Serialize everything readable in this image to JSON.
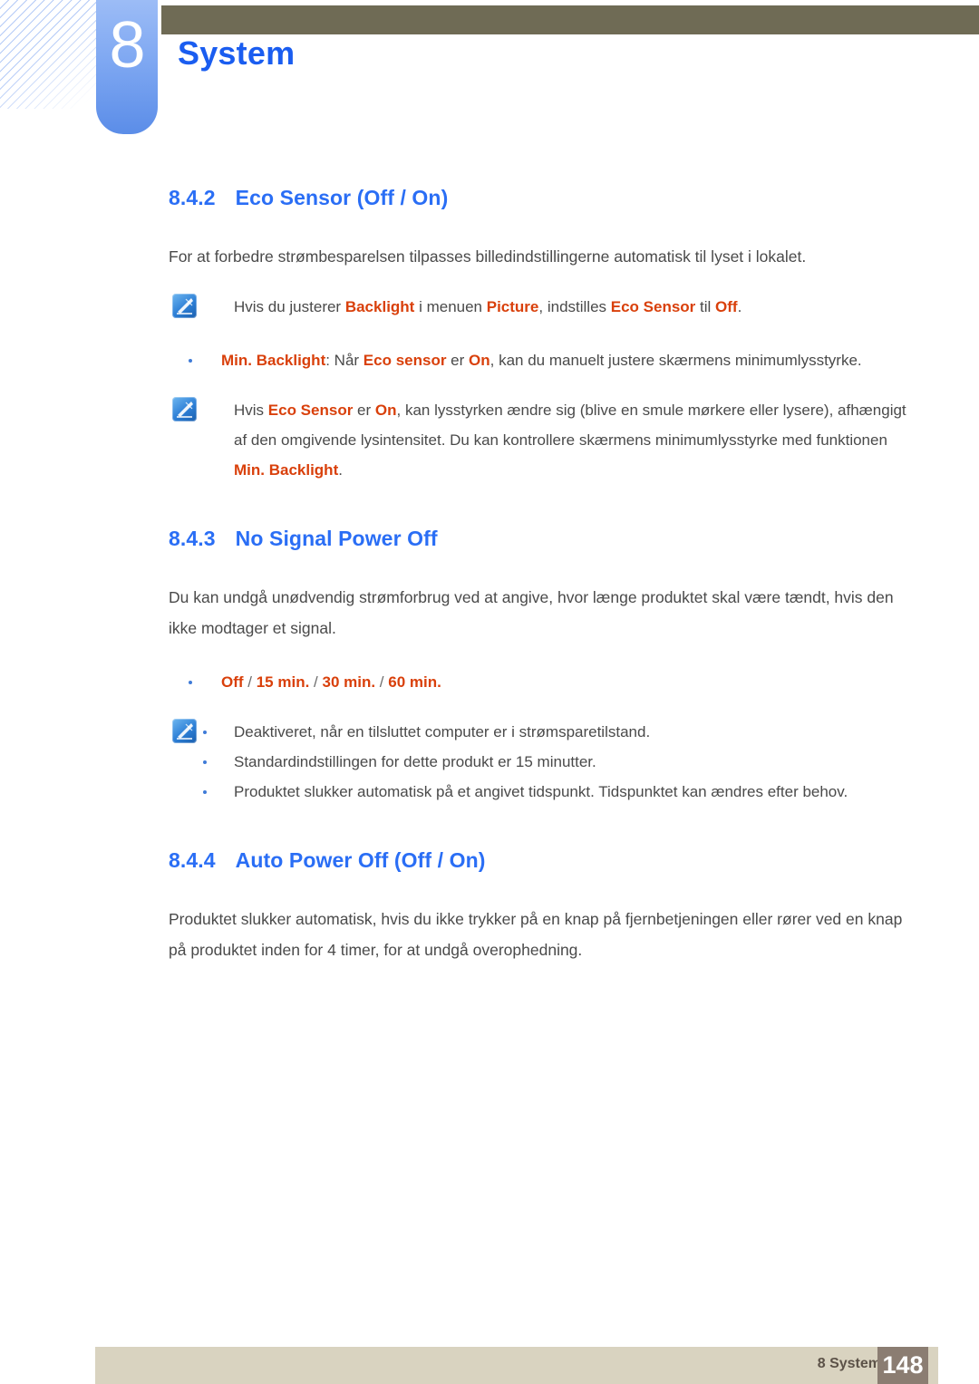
{
  "header": {
    "chapter_number": "8",
    "chapter_title": "System"
  },
  "sections": [
    {
      "number": "8.4.2",
      "title": "Eco Sensor (Off / On)"
    },
    {
      "number": "8.4.3",
      "title": "No Signal Power Off"
    },
    {
      "number": "8.4.4",
      "title": "Auto Power Off (Off / On)"
    }
  ],
  "eco_sensor": {
    "intro": "For at forbedre strømbesparelsen tilpasses billedindstillingerne automatisk til lyset i lokalet.",
    "note1": {
      "icon": "note-pen-icon",
      "text_parts": [
        {
          "t": "Hvis du justerer ",
          "hl": false
        },
        {
          "t": "Backlight",
          "hl": true
        },
        {
          "t": " i menuen ",
          "hl": false
        },
        {
          "t": "Picture",
          "hl": true
        },
        {
          "t": ", indstilles ",
          "hl": false
        },
        {
          "t": "Eco Sensor",
          "hl": true
        },
        {
          "t": " til ",
          "hl": false
        },
        {
          "t": "Off",
          "hl": true
        },
        {
          "t": ".",
          "hl": false
        }
      ]
    },
    "bullet1_parts": [
      {
        "t": "Min. Backlight",
        "hl": true
      },
      {
        "t": ": Når ",
        "hl": false
      },
      {
        "t": "Eco sensor",
        "hl": true
      },
      {
        "t": " er ",
        "hl": false
      },
      {
        "t": "On",
        "hl": true
      },
      {
        "t": ", kan du manuelt justere skærmens minimumlysstyrke.",
        "hl": false
      }
    ],
    "note2": {
      "icon": "note-pen-icon",
      "text_parts": [
        {
          "t": "Hvis ",
          "hl": false
        },
        {
          "t": "Eco Sensor",
          "hl": true
        },
        {
          "t": " er ",
          "hl": false
        },
        {
          "t": "On",
          "hl": true
        },
        {
          "t": ", kan lysstyrken ændre sig (blive en smule mørkere eller lysere), afhængigt af den omgivende lysintensitet. Du kan kontrollere skærmens minimumlysstyrke med funktionen ",
          "hl": false
        },
        {
          "t": "Min. Backlight",
          "hl": true
        },
        {
          "t": ".",
          "hl": false
        }
      ]
    }
  },
  "no_signal_power_off": {
    "intro": "Du kan undgå unødvendig strømforbrug ved at angive, hvor længe produktet skal være tændt, hvis den ikke modtager et signal.",
    "options_parts": [
      {
        "t": "Off",
        "hl": true
      },
      {
        "t": " / ",
        "sep": true
      },
      {
        "t": "15 min.",
        "hl": true
      },
      {
        "t": " / ",
        "sep": true
      },
      {
        "t": "30 min.",
        "hl": true
      },
      {
        "t": " / ",
        "sep": true
      },
      {
        "t": "60 min.",
        "hl": true
      }
    ],
    "note": {
      "icon": "note-pen-icon",
      "bullets": [
        "Deaktiveret, når en tilsluttet computer er i strømsparetilstand.",
        "Standardindstillingen for dette produkt er 15 minutter.",
        "Produktet slukker automatisk på et angivet tidspunkt. Tidspunktet kan ændres efter behov."
      ]
    }
  },
  "auto_power_off": {
    "intro": "Produktet slukker automatisk, hvis du ikke trykker på en knap på fjernbetjeningen eller rører ved en knap på produktet inden for 4 timer, for at undgå overophedning."
  },
  "footer": {
    "label": "8 System",
    "page_number": "148"
  },
  "colors": {
    "heading_blue": "#2a6ef5",
    "chapter_blue": "#1a5df0",
    "highlight_orange": "#d9400b",
    "body_gray": "#4a4a4a",
    "olive_bar": "#6f6b55",
    "footer_bar": "#d9d3c0",
    "footer_page_box": "#8b7d72",
    "tab_blue": "#7fa8f2"
  }
}
